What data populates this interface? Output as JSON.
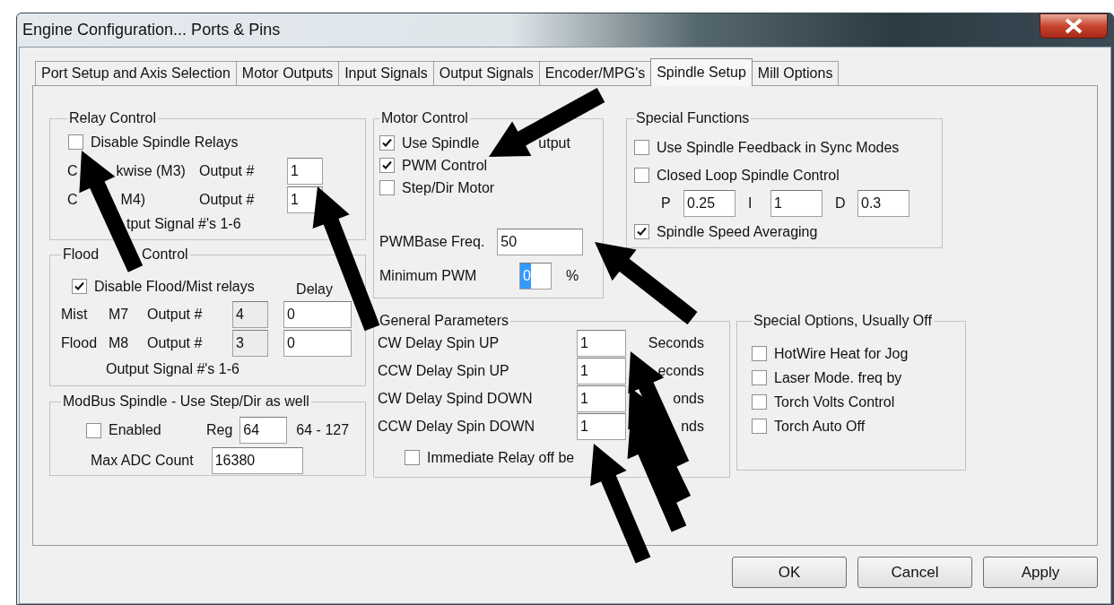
{
  "window": {
    "title": "Engine Configuration... Ports & Pins"
  },
  "tabs": [
    {
      "label": "Port Setup and Axis Selection",
      "selected": false
    },
    {
      "label": "Motor Outputs",
      "selected": false
    },
    {
      "label": "Input Signals",
      "selected": false
    },
    {
      "label": "Output Signals",
      "selected": false
    },
    {
      "label": "Encoder/MPG's",
      "selected": false
    },
    {
      "label": "Spindle Setup",
      "selected": true
    },
    {
      "label": "Mill Options",
      "selected": false
    }
  ],
  "relay_control": {
    "title": "Relay Control",
    "disable": {
      "label": "Disable Spindle Relays",
      "checked": false
    },
    "rows": [
      {
        "label_parts": [
          "C",
          "kwise (M3)"
        ],
        "output_label": "Output #",
        "value": "1"
      },
      {
        "label_parts": [
          "C",
          "M4)"
        ],
        "output_label": "Output #",
        "value": "1"
      }
    ],
    "note": "tput Signal #'s 1-6"
  },
  "flood_mist_control": {
    "title_parts": [
      "Flood",
      "Control"
    ],
    "disable": {
      "label": "Disable Flood/Mist relays",
      "checked": true
    },
    "delay_label": "Delay",
    "rows": [
      {
        "name": "Mist",
        "code": "M7",
        "output_label": "Output #",
        "output": "4",
        "output_disabled": true,
        "delay": "0"
      },
      {
        "name": "Flood",
        "code": "M8",
        "output_label": "Output #",
        "output": "3",
        "output_disabled": true,
        "delay": "0"
      }
    ],
    "note": "Output Signal #'s 1-6"
  },
  "modbus_spindle": {
    "title": "ModBus Spindle - Use Step/Dir as well",
    "enabled": {
      "label": "Enabled",
      "checked": false
    },
    "reg_label": "Reg",
    "reg": "64",
    "reg_range": "64 - 127",
    "max_adc_label": "Max ADC Count",
    "max_adc": "16380"
  },
  "motor_control": {
    "title": "Motor Control",
    "options": [
      {
        "label_parts": [
          "Use Spindle",
          "utput"
        ],
        "checked": true
      },
      {
        "label_parts": [
          "PWM Control"
        ],
        "checked": true
      },
      {
        "label_parts": [
          "Step/Dir Motor"
        ],
        "checked": false
      }
    ],
    "pwm_base_label": "PWMBase Freq.",
    "pwm_base": "50",
    "min_pwm_label": "Minimum PWM",
    "min_pwm": "0",
    "min_pwm_selected": true,
    "min_pwm_unit": "%"
  },
  "special_functions": {
    "title": "Special Functions",
    "options": [
      {
        "label": "Use Spindle Feedback in Sync Modes",
        "checked": false
      },
      {
        "label": "Closed Loop Spindle Control",
        "checked": false
      }
    ],
    "pid": [
      {
        "label": "P",
        "value": "0.25"
      },
      {
        "label": "I",
        "value": "1"
      },
      {
        "label": "D",
        "value": "0.3"
      }
    ],
    "averaging": {
      "label": "Spindle Speed Averaging",
      "checked": true
    }
  },
  "general_parameters": {
    "title": "General Parameters",
    "delays": [
      {
        "label": "CW Delay Spin UP",
        "value": "1",
        "unit": "Seconds"
      },
      {
        "label": "CCW Delay Spin UP",
        "value": "1",
        "unit": "econds"
      },
      {
        "label": "CW Delay Spind DOWN",
        "value": "1",
        "unit": "onds"
      },
      {
        "label": "CCW Delay Spin DOWN",
        "value": "1",
        "unit": "nds"
      }
    ],
    "immediate_relay": {
      "label": "Immediate Relay off be",
      "checked": false
    }
  },
  "special_options": {
    "title": "Special Options, Usually Off",
    "options": [
      {
        "label": "HotWire Heat for Jog",
        "checked": false
      },
      {
        "label": "Laser Mode. freq by",
        "checked": false
      },
      {
        "label": "Torch Volts Control",
        "checked": false
      },
      {
        "label": "Torch Auto Off",
        "checked": false
      }
    ]
  },
  "buttons": [
    {
      "label": "OK"
    },
    {
      "label": "Cancel"
    },
    {
      "label": "Apply"
    }
  ]
}
